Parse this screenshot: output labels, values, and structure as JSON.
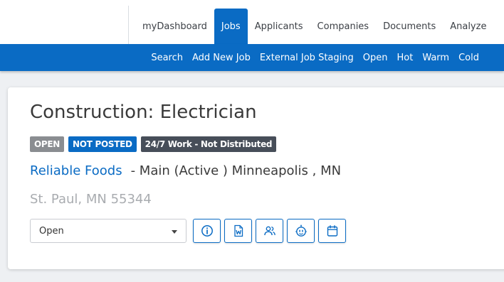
{
  "nav": {
    "tabs": [
      {
        "label": "myDashboard"
      },
      {
        "label": "Jobs"
      },
      {
        "label": "Applicants"
      },
      {
        "label": "Companies"
      },
      {
        "label": "Documents"
      },
      {
        "label": "Analyze"
      }
    ],
    "active_tab": "Jobs"
  },
  "subnav": {
    "items": [
      {
        "label": "Search"
      },
      {
        "label": "Add New Job"
      },
      {
        "label": "External Job Staging"
      },
      {
        "label": "Open"
      },
      {
        "label": "Hot"
      },
      {
        "label": "Warm"
      },
      {
        "label": "Cold"
      }
    ]
  },
  "job": {
    "title": "Construction: Electrician",
    "badges": {
      "open": "OPEN",
      "not_posted": "NOT POSTED",
      "distribution": "24/7 Work - Not Distributed"
    },
    "company": "Reliable Foods",
    "location_detail": "- Main (Active ) Minneapolis , MN",
    "address": "St. Paul, MN 55344",
    "status": {
      "selected": "Open"
    }
  },
  "actions": [
    {
      "icon": "info-icon"
    },
    {
      "icon": "word-document-icon"
    },
    {
      "icon": "users-icon"
    },
    {
      "icon": "robot-icon"
    },
    {
      "icon": "calendar-icon"
    }
  ],
  "colors": {
    "brand_blue": "#0a6bc4",
    "badge_gray": "#8a8d91",
    "badge_dark": "#474e59",
    "muted_text": "#a9acb0"
  }
}
